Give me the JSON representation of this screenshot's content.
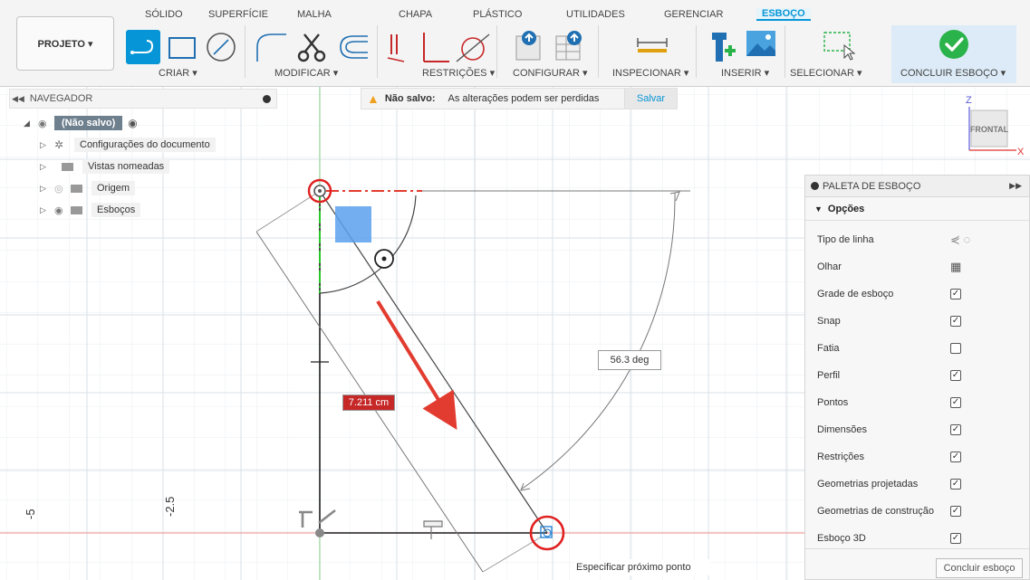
{
  "toolbar": {
    "tabs": [
      {
        "label": "SÓLIDO",
        "active": false
      },
      {
        "label": "SUPERFÍCIE",
        "active": false
      },
      {
        "label": "MALHA",
        "active": false
      },
      {
        "label": "CHAPA",
        "active": false
      },
      {
        "label": "PLÁSTICO",
        "active": false
      },
      {
        "label": "UTILIDADES",
        "active": false
      },
      {
        "label": "GERENCIAR",
        "active": false
      },
      {
        "label": "ESBOÇO",
        "active": true
      }
    ],
    "project_button": "PROJETO ▾",
    "groups": {
      "criar": "CRIAR ▾",
      "modificar": "MODIFICAR ▾",
      "restricoes": "RESTRIÇÕES ▾",
      "configurar": "CONFIGURAR ▾",
      "inspecionar": "INSPECIONAR ▾",
      "inserir": "INSERIR ▾",
      "selecionar": "SELECIONAR ▾",
      "concluir": "CONCLUIR ESBOÇO ▾"
    },
    "accent_color": "#0696d7",
    "finish_color": "#2ab34a"
  },
  "navigator": {
    "title": "NAVEGADOR",
    "root": "(Não salvo)",
    "items": [
      {
        "label": "Configurações do documento",
        "icon": "gear-icon"
      },
      {
        "label": "Vistas nomeadas",
        "icon": "folder-icon"
      },
      {
        "label": "Origem",
        "icon": "folder-icon"
      },
      {
        "label": "Esboços",
        "icon": "folder-icon"
      }
    ]
  },
  "warning": {
    "title": "Não salvo:",
    "message": "As alterações podem ser perdidas",
    "save_label": "Salvar"
  },
  "canvas": {
    "dimension_value": "7.211 cm",
    "angle_value": "56.3 deg",
    "axis_labels": [
      "-5",
      "-2.5"
    ],
    "status_tip": "Especificar próximo ponto"
  },
  "viewcube": {
    "face_label": "FRONTAL",
    "axis_z": "Z",
    "axis_x": "X"
  },
  "palette": {
    "title": "PALETA DE ESBOÇO",
    "section": "Opções",
    "rows": [
      {
        "label": "Tipo de linha",
        "control": "linetype"
      },
      {
        "label": "Olhar",
        "control": "look"
      },
      {
        "label": "Grade de esboço",
        "control": "checkbox",
        "checked": true
      },
      {
        "label": "Snap",
        "control": "checkbox",
        "checked": true
      },
      {
        "label": "Fatia",
        "control": "checkbox",
        "checked": false
      },
      {
        "label": "Perfil",
        "control": "checkbox",
        "checked": true
      },
      {
        "label": "Pontos",
        "control": "checkbox",
        "checked": true
      },
      {
        "label": "Dimensões",
        "control": "checkbox",
        "checked": true
      },
      {
        "label": "Restrições",
        "control": "checkbox",
        "checked": true
      },
      {
        "label": "Geometrias projetadas",
        "control": "checkbox",
        "checked": true
      },
      {
        "label": "Geometrias de construção",
        "control": "checkbox",
        "checked": true
      },
      {
        "label": "Esboço 3D",
        "control": "checkbox",
        "checked": true
      }
    ],
    "finish_button": "Concluir esboço"
  }
}
